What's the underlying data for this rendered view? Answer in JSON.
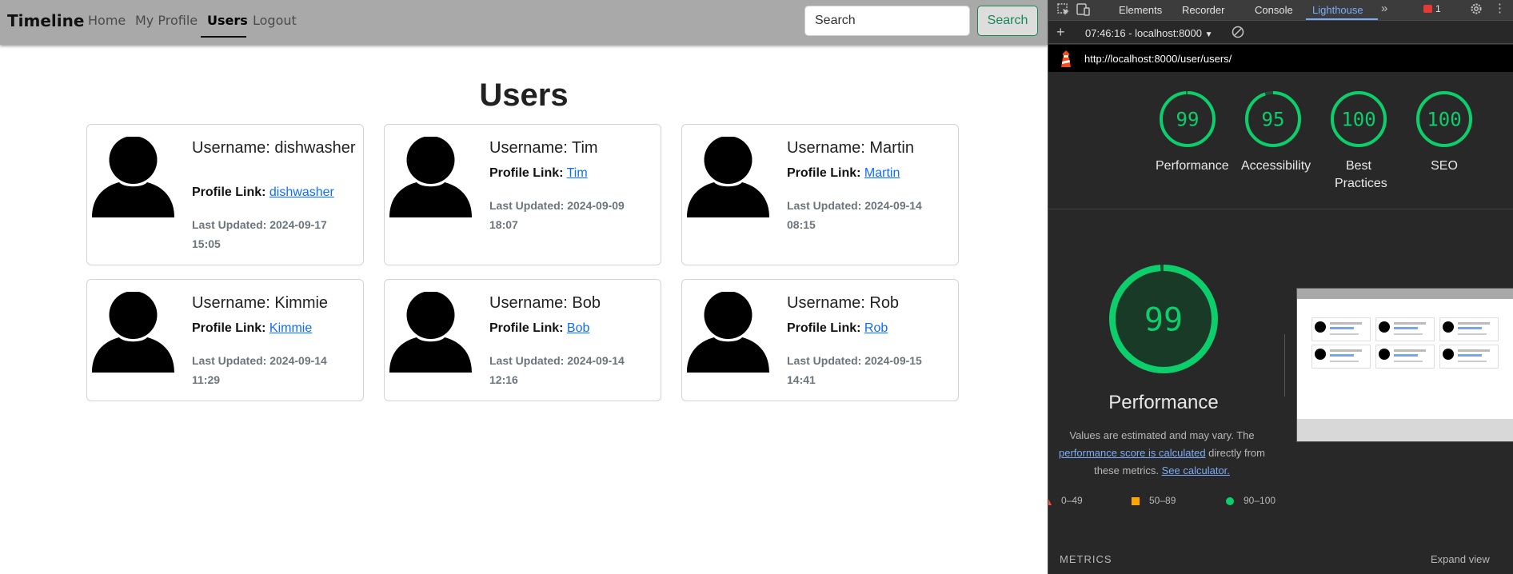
{
  "navbar": {
    "brand": "Timeline",
    "links": [
      "Home",
      "My Profile",
      "Users",
      "Logout"
    ],
    "active": "Users",
    "search_placeholder": "Search",
    "search_button": "Search"
  },
  "page": {
    "title": "Users"
  },
  "users": [
    {
      "username_text": "Username: dishwasher",
      "profile_label": "Profile Link:",
      "profile_link": "dishwasher",
      "updated_line1": "Last Updated: 2024-09-17",
      "updated_line2": "15:05"
    },
    {
      "username_text": "Username: Tim",
      "profile_label": "Profile Link:",
      "profile_link": "Tim",
      "updated_line1": "Last Updated: 2024-09-09",
      "updated_line2": "18:07"
    },
    {
      "username_text": "Username: Martin",
      "profile_label": "Profile Link:",
      "profile_link": "Martin",
      "updated_line1": "Last Updated: 2024-09-14",
      "updated_line2": "08:15"
    },
    {
      "username_text": "Username: Kimmie",
      "profile_label": "Profile Link:",
      "profile_link": "Kimmie",
      "updated_line1": "Last Updated: 2024-09-14",
      "updated_line2": "11:29"
    },
    {
      "username_text": "Username: Bob",
      "profile_label": "Profile Link:",
      "profile_link": "Bob",
      "updated_line1": "Last Updated: 2024-09-14",
      "updated_line2": "12:16"
    },
    {
      "username_text": "Username: Rob",
      "profile_label": "Profile Link:",
      "profile_link": "Rob",
      "updated_line1": "Last Updated: 2024-09-15",
      "updated_line2": "14:41"
    }
  ],
  "devtools": {
    "tabs": [
      "Elements",
      "Recorder",
      "Console",
      "Lighthouse"
    ],
    "active_tab": "Lighthouse",
    "more_tabs_icon": "chevron-double-right-icon",
    "error_count": "1",
    "report_selector": "07:46:16 - localhost:8000",
    "url": "http://localhost:8000/user/users/",
    "scores": [
      {
        "label": "Performance",
        "value": "99",
        "score": 99
      },
      {
        "label": "Accessibility",
        "value": "95",
        "score": 95
      },
      {
        "label": "Best Practices",
        "value": "100",
        "score": 100
      },
      {
        "label": "SEO",
        "value": "100",
        "score": 100
      }
    ],
    "performance": {
      "value": "99",
      "score": 99,
      "title": "Performance",
      "desc_prefix": "Values are estimated and may vary. The",
      "desc_link1": "performance score is calculated",
      "desc_mid": "directly from these metrics.",
      "desc_link2": "See calculator."
    },
    "legend": [
      {
        "range": "0–49",
        "color": "#ff4e42"
      },
      {
        "range": "50–89",
        "color": "#ffa400"
      },
      {
        "range": "90–100",
        "color": "#0cce6b"
      }
    ],
    "metrics_label": "METRICS",
    "expand_label": "Expand view",
    "colors": {
      "pass_green": "#0cce6b",
      "gauge_text": "#0cce6b",
      "panel_bg": "#282828",
      "accent_blue": "#7cacf8"
    }
  }
}
